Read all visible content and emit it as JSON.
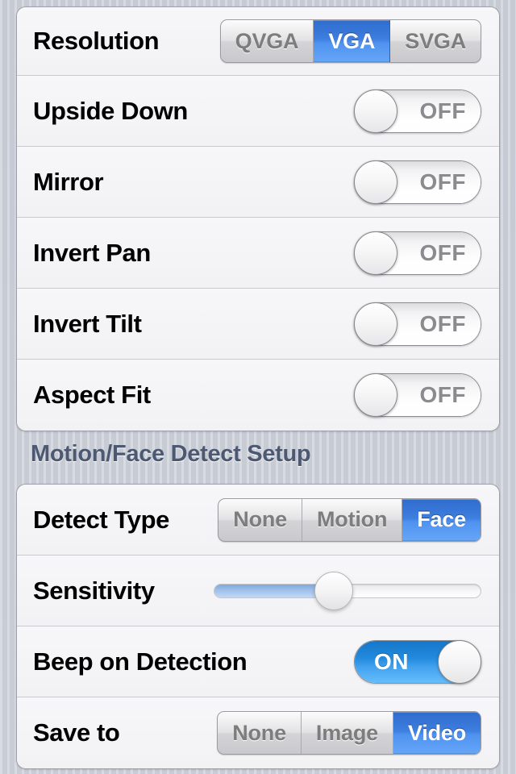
{
  "groups": [
    {
      "name": "camera-settings",
      "rows": [
        {
          "label": "Resolution",
          "control": "segmented",
          "options": [
            "QVGA",
            "VGA",
            "SVGA"
          ],
          "selected": 1
        },
        {
          "label": "Upside Down",
          "control": "switch",
          "state": "OFF",
          "on": false
        },
        {
          "label": "Mirror",
          "control": "switch",
          "state": "OFF",
          "on": false
        },
        {
          "label": "Invert Pan",
          "control": "switch",
          "state": "OFF",
          "on": false
        },
        {
          "label": "Invert Tilt",
          "control": "switch",
          "state": "OFF",
          "on": false
        },
        {
          "label": "Aspect Fit",
          "control": "switch",
          "state": "OFF",
          "on": false
        }
      ]
    },
    {
      "name": "motion-face-detect",
      "header": "Motion/Face Detect Setup",
      "rows": [
        {
          "label": "Detect Type",
          "control": "segmented",
          "options": [
            "None",
            "Motion",
            "Face"
          ],
          "selected": 2
        },
        {
          "label": "Sensitivity",
          "control": "slider",
          "value": 45,
          "min": 0,
          "max": 100
        },
        {
          "label": "Beep on Detection",
          "control": "switch",
          "state": "ON",
          "on": true
        },
        {
          "label": "Save to",
          "control": "segmented",
          "options": [
            "None",
            "Image",
            "Video"
          ],
          "selected": 2
        }
      ]
    }
  ],
  "colors": {
    "accent_blue": "#4f93f0",
    "switch_on_blue": "#2289dd",
    "page_background": "#c5cad3",
    "row_background": "#f4f4f6",
    "label_text": "#000000",
    "header_text": "#4d5972",
    "segment_inactive_text": "#7d7d7d",
    "switch_off_text": "#8b8b8f"
  }
}
